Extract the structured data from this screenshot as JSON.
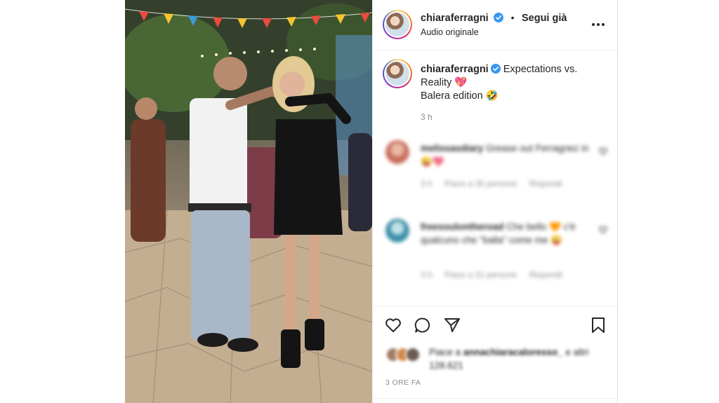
{
  "post": {
    "username": "chiaraferragni",
    "follow_status": "Segui già",
    "audio": "Audio originale",
    "caption_lines": [
      "Expectations vs.",
      "Reality 💖",
      "Balera edition 🤣"
    ],
    "caption_time": "3 h",
    "date": "3 ORE FA"
  },
  "comments": [
    {
      "username": "melissasdiary",
      "text": "Grease out Ferragnez in 😜💖",
      "time": "3 h",
      "likes": "Piace a 35 persone",
      "reply": "Rispondi"
    },
    {
      "username": "freesoulontheroad",
      "text": "Che bello 🧡 c'è qualcuno che \"balla\" come me 😜",
      "time": "3 h",
      "likes": "Piace a 31 persone",
      "reply": "Rispondi"
    }
  ],
  "likes_summary": {
    "prefix": "Piace a",
    "user": "annachiaracaloresso_",
    "suffix": "e altri 128.621"
  },
  "icons": {
    "verified": "verified-badge-icon",
    "more": "more-options-icon",
    "like": "heart-icon",
    "comment": "comment-icon",
    "share": "share-icon",
    "save": "bookmark-icon"
  },
  "colors": {
    "verified_blue": "#3897f0",
    "text": "#262626",
    "muted": "#8e8e8e"
  }
}
